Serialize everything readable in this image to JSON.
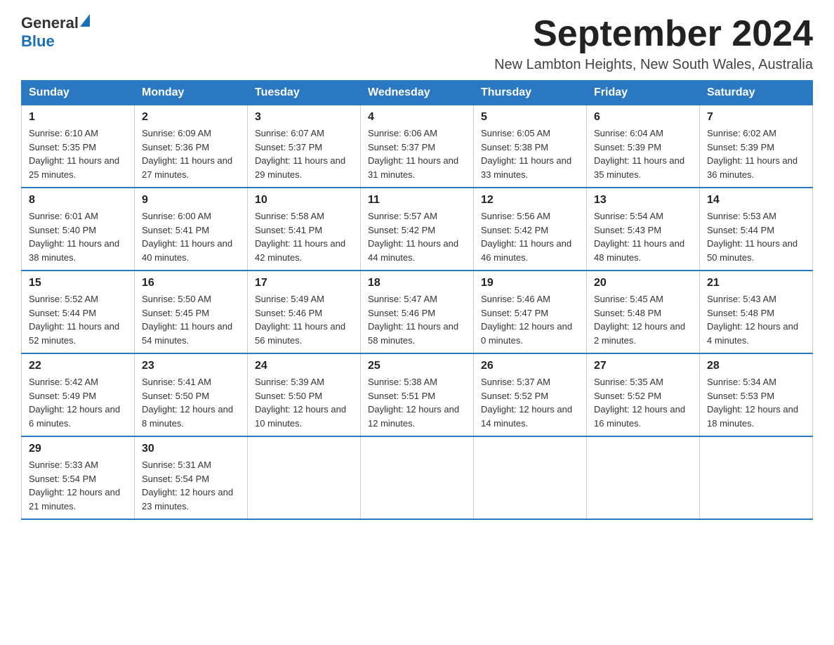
{
  "header": {
    "logo": {
      "general": "General",
      "triangle_shape": "▶",
      "blue": "Blue"
    },
    "month_title": "September 2024",
    "location": "New Lambton Heights, New South Wales, Australia"
  },
  "days_of_week": [
    "Sunday",
    "Monday",
    "Tuesday",
    "Wednesday",
    "Thursday",
    "Friday",
    "Saturday"
  ],
  "weeks": [
    [
      {
        "day": "1",
        "sunrise": "6:10 AM",
        "sunset": "5:35 PM",
        "daylight": "11 hours and 25 minutes."
      },
      {
        "day": "2",
        "sunrise": "6:09 AM",
        "sunset": "5:36 PM",
        "daylight": "11 hours and 27 minutes."
      },
      {
        "day": "3",
        "sunrise": "6:07 AM",
        "sunset": "5:37 PM",
        "daylight": "11 hours and 29 minutes."
      },
      {
        "day": "4",
        "sunrise": "6:06 AM",
        "sunset": "5:37 PM",
        "daylight": "11 hours and 31 minutes."
      },
      {
        "day": "5",
        "sunrise": "6:05 AM",
        "sunset": "5:38 PM",
        "daylight": "11 hours and 33 minutes."
      },
      {
        "day": "6",
        "sunrise": "6:04 AM",
        "sunset": "5:39 PM",
        "daylight": "11 hours and 35 minutes."
      },
      {
        "day": "7",
        "sunrise": "6:02 AM",
        "sunset": "5:39 PM",
        "daylight": "11 hours and 36 minutes."
      }
    ],
    [
      {
        "day": "8",
        "sunrise": "6:01 AM",
        "sunset": "5:40 PM",
        "daylight": "11 hours and 38 minutes."
      },
      {
        "day": "9",
        "sunrise": "6:00 AM",
        "sunset": "5:41 PM",
        "daylight": "11 hours and 40 minutes."
      },
      {
        "day": "10",
        "sunrise": "5:58 AM",
        "sunset": "5:41 PM",
        "daylight": "11 hours and 42 minutes."
      },
      {
        "day": "11",
        "sunrise": "5:57 AM",
        "sunset": "5:42 PM",
        "daylight": "11 hours and 44 minutes."
      },
      {
        "day": "12",
        "sunrise": "5:56 AM",
        "sunset": "5:42 PM",
        "daylight": "11 hours and 46 minutes."
      },
      {
        "day": "13",
        "sunrise": "5:54 AM",
        "sunset": "5:43 PM",
        "daylight": "11 hours and 48 minutes."
      },
      {
        "day": "14",
        "sunrise": "5:53 AM",
        "sunset": "5:44 PM",
        "daylight": "11 hours and 50 minutes."
      }
    ],
    [
      {
        "day": "15",
        "sunrise": "5:52 AM",
        "sunset": "5:44 PM",
        "daylight": "11 hours and 52 minutes."
      },
      {
        "day": "16",
        "sunrise": "5:50 AM",
        "sunset": "5:45 PM",
        "daylight": "11 hours and 54 minutes."
      },
      {
        "day": "17",
        "sunrise": "5:49 AM",
        "sunset": "5:46 PM",
        "daylight": "11 hours and 56 minutes."
      },
      {
        "day": "18",
        "sunrise": "5:47 AM",
        "sunset": "5:46 PM",
        "daylight": "11 hours and 58 minutes."
      },
      {
        "day": "19",
        "sunrise": "5:46 AM",
        "sunset": "5:47 PM",
        "daylight": "12 hours and 0 minutes."
      },
      {
        "day": "20",
        "sunrise": "5:45 AM",
        "sunset": "5:48 PM",
        "daylight": "12 hours and 2 minutes."
      },
      {
        "day": "21",
        "sunrise": "5:43 AM",
        "sunset": "5:48 PM",
        "daylight": "12 hours and 4 minutes."
      }
    ],
    [
      {
        "day": "22",
        "sunrise": "5:42 AM",
        "sunset": "5:49 PM",
        "daylight": "12 hours and 6 minutes."
      },
      {
        "day": "23",
        "sunrise": "5:41 AM",
        "sunset": "5:50 PM",
        "daylight": "12 hours and 8 minutes."
      },
      {
        "day": "24",
        "sunrise": "5:39 AM",
        "sunset": "5:50 PM",
        "daylight": "12 hours and 10 minutes."
      },
      {
        "day": "25",
        "sunrise": "5:38 AM",
        "sunset": "5:51 PM",
        "daylight": "12 hours and 12 minutes."
      },
      {
        "day": "26",
        "sunrise": "5:37 AM",
        "sunset": "5:52 PM",
        "daylight": "12 hours and 14 minutes."
      },
      {
        "day": "27",
        "sunrise": "5:35 AM",
        "sunset": "5:52 PM",
        "daylight": "12 hours and 16 minutes."
      },
      {
        "day": "28",
        "sunrise": "5:34 AM",
        "sunset": "5:53 PM",
        "daylight": "12 hours and 18 minutes."
      }
    ],
    [
      {
        "day": "29",
        "sunrise": "5:33 AM",
        "sunset": "5:54 PM",
        "daylight": "12 hours and 21 minutes."
      },
      {
        "day": "30",
        "sunrise": "5:31 AM",
        "sunset": "5:54 PM",
        "daylight": "12 hours and 23 minutes."
      },
      null,
      null,
      null,
      null,
      null
    ]
  ]
}
